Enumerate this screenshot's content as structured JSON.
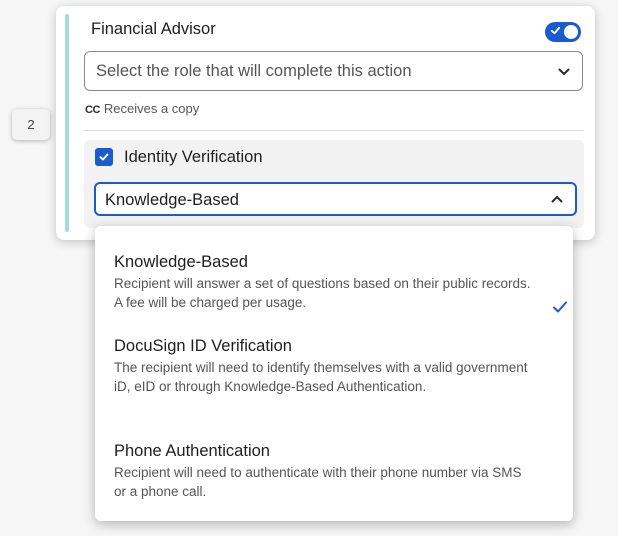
{
  "step": {
    "number": "2"
  },
  "recipient": {
    "role_title": "Financial Advisor",
    "toggle_enabled": true,
    "role_select_placeholder": "Select the role that will complete this action",
    "cc_icon": "CC",
    "cc_label": "Receives a copy"
  },
  "authentication": {
    "checkbox_checked": true,
    "label": "Identity Verification",
    "selected_method": "Knowledge-Based",
    "options": [
      {
        "title": "Knowledge-Based",
        "description": "Recipient will answer a set of questions based on their public records. A fee will be charged per usage.",
        "selected": true
      },
      {
        "title": "DocuSign ID Verification",
        "description": "The recipient will need to identify themselves with a valid government iD, eID or through Knowledge-Based Authentication.",
        "selected": false
      },
      {
        "title": "Phone Authentication",
        "description": "Recipient will need to authenticate with their phone number via SMS or a phone call.",
        "selected": false
      }
    ]
  },
  "colors": {
    "accent_blue": "#1a5cce",
    "accent_bar": "#a9dadb"
  },
  "icons": {
    "toggle": "toggle-on-check-icon",
    "select_chevron": "chevron-down-icon",
    "method_chevron": "chevron-up-icon",
    "checkbox": "checkmark-icon",
    "option_selected": "checkmark-icon"
  }
}
